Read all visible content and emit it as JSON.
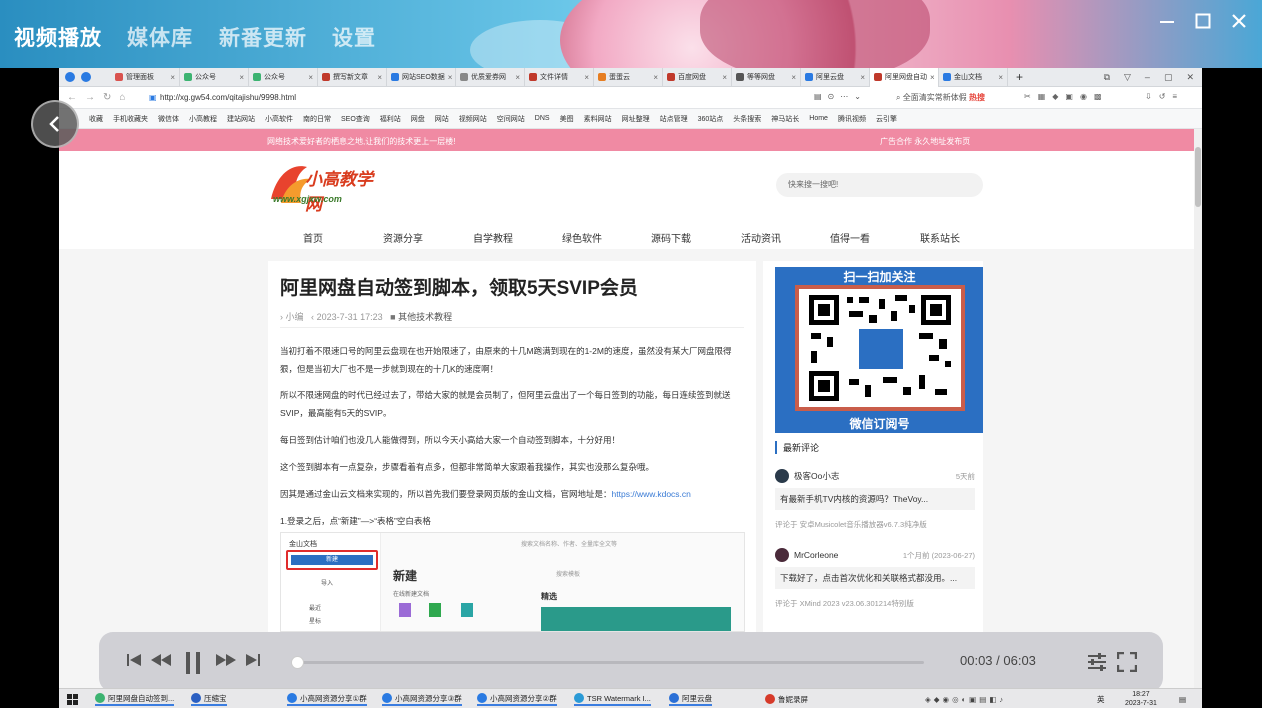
{
  "app": {
    "tabs": [
      "视频播放",
      "媒体库",
      "新番更新",
      "设置"
    ],
    "active_tab": "视频播放",
    "window_controls": [
      "minimize-icon",
      "maximize-icon",
      "close-icon"
    ]
  },
  "browser": {
    "tabs": [
      "管理面板",
      "公众号",
      "公众号",
      "撰写新文章",
      "网站SEO数据",
      "优质爱券网",
      "文件详情",
      "蛋蛋云",
      "百度网盘",
      "等等网盘",
      "阿里云盘",
      "阿里网盘自动",
      "金山文档"
    ],
    "active_tab_index": 11,
    "url": "http://xg.gw54.com/qitajishu/9998.html",
    "search_placeholder": "全面清实常新体假",
    "hot_label": "热搜",
    "bookmarks": [
      "收藏",
      "手机收藏夹",
      "微信体",
      "小高教程",
      "建站网站",
      "小高软件",
      "南的日常",
      "SEO查询",
      "福利站",
      "网盘",
      "网站",
      "视频网站",
      "空间网站",
      "DNS",
      "美图",
      "素料网站",
      "网址整理",
      "站点管理",
      "360站点",
      "头条搜索",
      "神马站长",
      "Home",
      "腾讯视频",
      "云引擎"
    ]
  },
  "site": {
    "notice": "网络技术爱好者的栖息之地,让我们的技术更上一层楼!",
    "notice_right": "广告合作   永久地址发布页",
    "logo_text": "小高教学网",
    "logo_sub": "www.xgjxw.com",
    "search_placeholder": "快来搜一搜吧!",
    "nav": [
      "首页",
      "资源分享",
      "自学教程",
      "绿色软件",
      "源码下载",
      "活动资讯",
      "值得一看",
      "联系站长"
    ]
  },
  "article": {
    "title": "阿里网盘自动签到脚本，领取5天SVIP会员",
    "author": "小编",
    "date": "2023-7-31 17:23",
    "category": "其他技术教程",
    "paragraphs": [
      "当初打着不限速口号的阿里云盘现在也开始限速了，由原来的十几M跑满到现在的1-2M的速度，虽然没有某大厂网盘限得狠，但是当初大厂也不是一步就到现在的十几K的速度啊！",
      "所以不限速网盘的时代已经过去了，带给大家的就是会员制了，但阿里云盘出了一个每日签到的功能，每日连续签到就送SVIP，最高能有5天的SVIP。",
      "每日签到估计咱们也没几人能做得到，所以今天小高给大家一个自动签到脚本，十分好用！",
      "这个签到脚本有一点复杂，步骤看着有点多，但都非常简单大家跟着我操作，其实也没那么复杂哦。",
      "因其是通过金山云文档来实现的，所以首先我们要登录网页版的金山文档，官网地址是：",
      "1.登录之后，点“新建”—>“表格”空白表格"
    ],
    "link": "https://www.kdocs.cn",
    "screenshot": {
      "app_name": "金山文档",
      "new_button": "新建",
      "import_button": "导入",
      "panel_title": "新建",
      "recent": "最近",
      "starred": "星标",
      "section": "在线新建文档",
      "picks": "精选",
      "search": "搜索模板",
      "search_doc": "搜索文档名称、作者、全量库全文等"
    }
  },
  "sidebar": {
    "qr_top": "扫一扫加关注",
    "qr_bottom": "微信订阅号",
    "comments_title": "最新评论",
    "comments": [
      {
        "name": "极客Oo小志",
        "time": "5天前",
        "text": "有最新手机TV内核的资源吗？TheVoy...",
        "ref": "评论于 安卓Musicolet音乐播放器v6.7.3纯净版"
      },
      {
        "name": "MrCorleone",
        "time": "1个月前 (2023-06-27)",
        "text": "下载好了，点击首次优化和关联格式都没用。...",
        "ref": "评论于 XMind 2023 v23.06.301214特别版"
      }
    ]
  },
  "player": {
    "current_time": "00:03",
    "total_time": "06:03",
    "time_display": "00:03 / 06:03",
    "progress": 0.008
  },
  "taskbar": {
    "items": [
      "阿里网盘自动签到...",
      "压缩宝",
      "小高网资源分享①群",
      "小高网资源分享③群",
      "小高网资源分享②群",
      "TSR Watermark I...",
      "阿里云盘",
      "鲁妮录屏"
    ],
    "clock_time": "18:27",
    "clock_date": "2023-7-31",
    "ime": "英"
  },
  "colors": {
    "accent": "#2b6fc2",
    "notice_bar": "#f08aa3",
    "link": "#3a7bd5"
  }
}
